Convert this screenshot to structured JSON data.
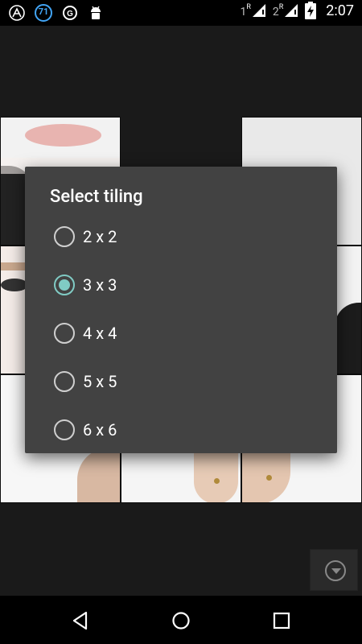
{
  "status_bar": {
    "time": "2:07",
    "sim1": {
      "number": "1",
      "roaming": "R"
    },
    "sim2": {
      "number": "2",
      "roaming": "R"
    },
    "notification_icons": [
      "app-a-icon",
      "badge-71-icon",
      "sync-icon",
      "android-icon"
    ],
    "badge_number": "71"
  },
  "dialog": {
    "title": "Select tiling",
    "options": [
      {
        "label": "2 x 2",
        "selected": false
      },
      {
        "label": "3 x 3",
        "selected": true
      },
      {
        "label": "4 x 4",
        "selected": false
      },
      {
        "label": "5 x 5",
        "selected": false
      },
      {
        "label": "6 x 6",
        "selected": false
      }
    ],
    "accent_color": "#80cbc4"
  },
  "floating_button": {
    "icon": "chevron-down-circle-icon"
  },
  "nav_bar": {
    "buttons": [
      "back-icon",
      "home-icon",
      "recents-icon"
    ]
  }
}
